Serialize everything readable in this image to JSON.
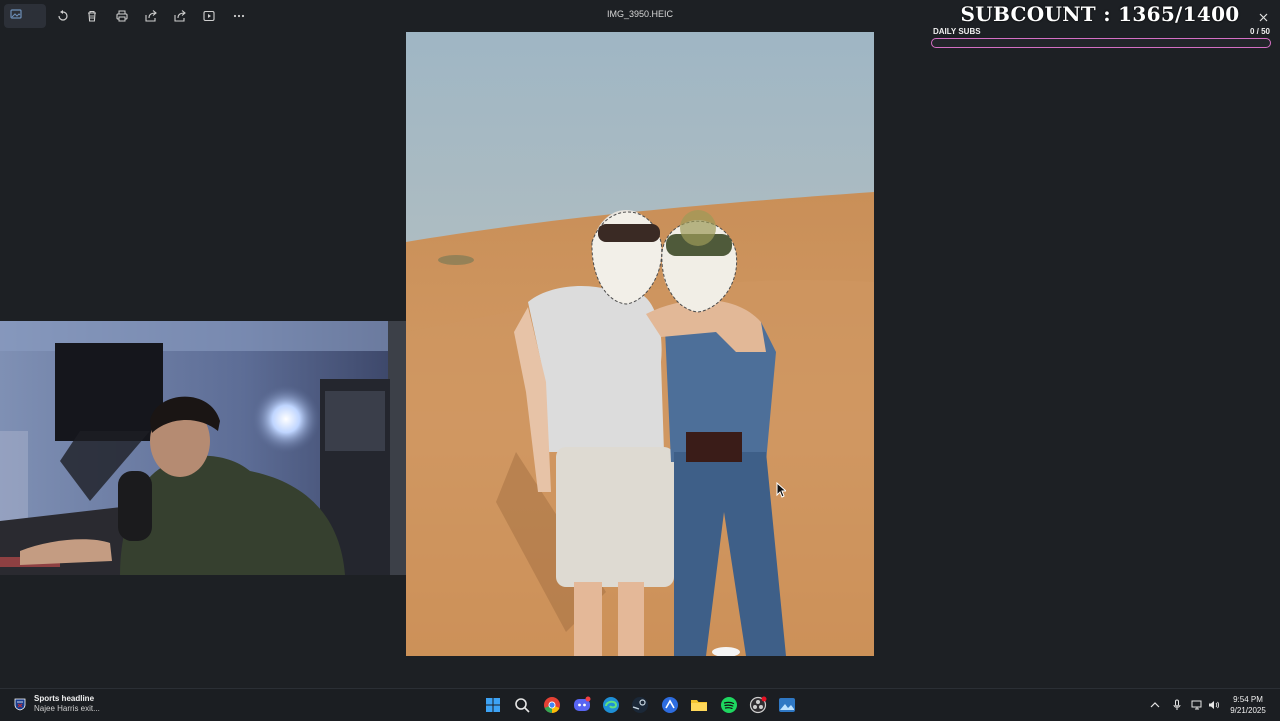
{
  "window": {
    "file_title": "IMG_3950.HEIC",
    "toolbar_icons": [
      "photos-app-icon",
      "rotate-icon",
      "delete-icon",
      "print-icon",
      "share-icon",
      "share-alt-icon",
      "slideshow-icon",
      "more-icon",
      "close-icon"
    ]
  },
  "overlay": {
    "subcount": "SUBCOUNT : 1365/1400",
    "daily_label": "DAILY SUBS",
    "daily_count": "0   / 50",
    "daily_progress": 0,
    "accent_color": "#d46fc4"
  },
  "taskbar": {
    "news_headline": "Sports headline",
    "news_sub": "Najee Harris exit...",
    "apps": [
      "windows-start-icon",
      "search-icon",
      "chrome-icon",
      "discord-icon",
      "edge-icon",
      "steam-icon",
      "app-icon",
      "file-explorer-icon",
      "spotify-icon",
      "obs-icon",
      "photos-icon"
    ],
    "tray_icons": [
      "chevron-up-icon",
      "microphone-icon",
      "network-icon",
      "volume-icon"
    ],
    "time": "9:54 PM",
    "date": "9/21/2025"
  }
}
